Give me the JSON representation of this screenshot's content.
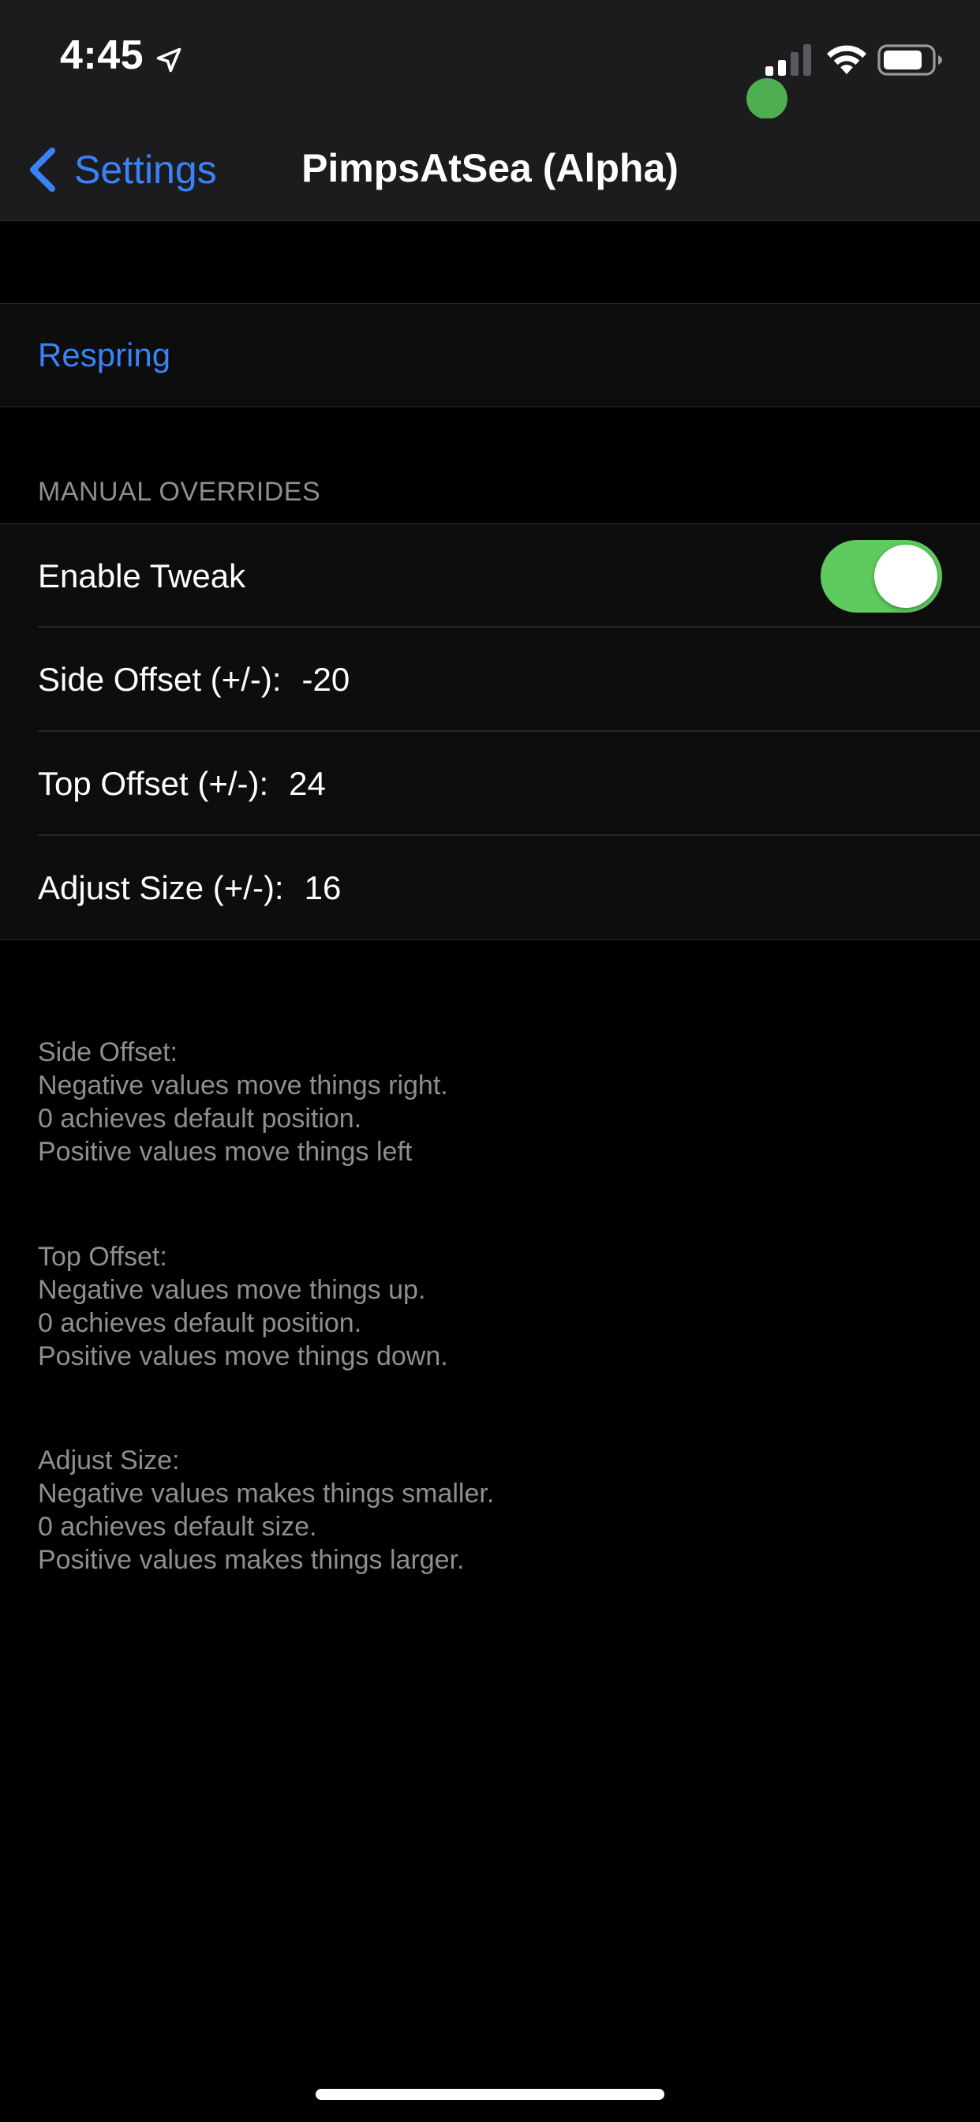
{
  "status_bar": {
    "time": "4:45",
    "location_icon": "location-arrow-icon",
    "cellular_icon": "cellular-signal-icon",
    "wifi_icon": "wifi-icon",
    "battery_icon": "battery-icon",
    "camera_indicator_color": "#4fae52"
  },
  "nav": {
    "back_label": "Settings",
    "back_icon": "chevron-left-icon",
    "title": "PimpsAtSea (Alpha)"
  },
  "actions": {
    "respring_label": "Respring"
  },
  "manual_overrides": {
    "header": "MANUAL OVERRIDES",
    "enable_tweak": {
      "label": "Enable Tweak",
      "on": true
    },
    "side_offset": {
      "label": "Side Offset (+/-):",
      "value": "-20"
    },
    "top_offset": {
      "label": "Top Offset (+/-):",
      "value": "24"
    },
    "adjust_size": {
      "label": "Adjust Size (+/-):",
      "value": "16"
    }
  },
  "footer": {
    "side_offset": "Side Offset:\nNegative values move things right.\n0 achieves default position.\nPositive values move things left",
    "top_offset": "Top Offset:\nNegative values move things up.\n0 achieves default position.\nPositive values move things down.",
    "adjust_size": "Adjust Size:\nNegative values makes things smaller.\n0 achieves default size.\nPositive values makes things larger."
  },
  "colors": {
    "accent_blue": "#3a82f7",
    "toggle_green": "#5fcb5e",
    "secondary_text": "#8e8e93"
  }
}
